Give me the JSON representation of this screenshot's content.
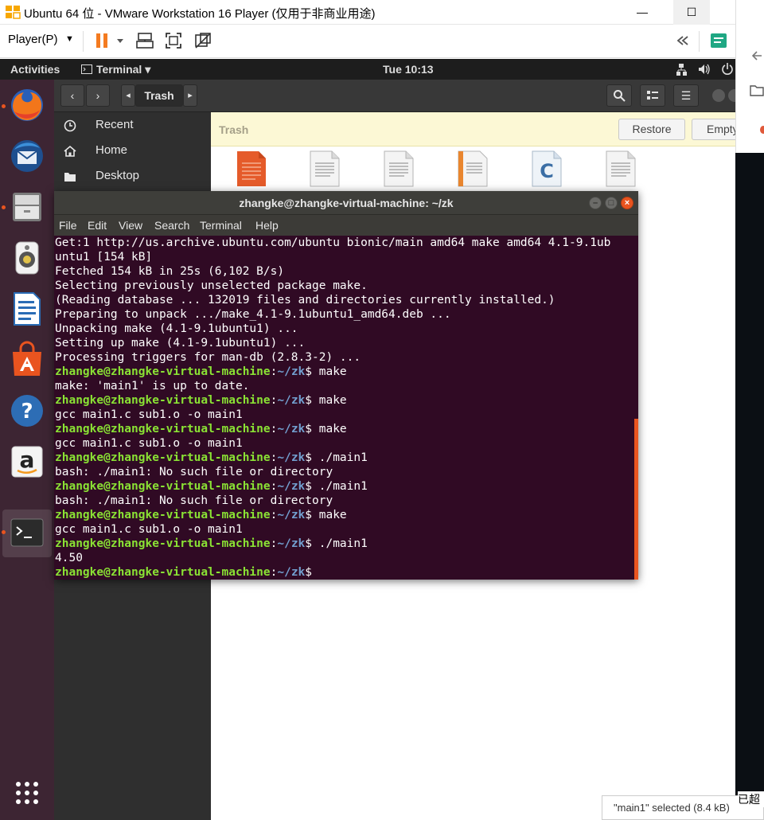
{
  "vmware": {
    "title": "Ubuntu 64 位 - VMware Workstation 16 Player (仅用于非商业用途)",
    "min_glyph": "—",
    "max_glyph": "☐",
    "player_menu": "Player(P)",
    "caret": "▼",
    "icons": [
      "pause-icon",
      "send-ctrl-alt-del-icon",
      "fit-guest-icon",
      "unity-icon",
      "collapse-icon",
      "notes-icon"
    ],
    "accent": "#f47b20"
  },
  "ubuntu": {
    "activities": "Activities",
    "app_menu": "Terminal ▾",
    "clock": "Tue 10:13",
    "dock_icons": [
      "firefox-icon",
      "thunderbird-icon",
      "files-icon",
      "rhythmbox-icon",
      "writer-icon",
      "software-center-icon",
      "help-icon",
      "amazon-icon",
      "terminal-icon",
      "show-apps-icon"
    ]
  },
  "nautilus": {
    "breadcrumb": "Trash",
    "sidebar": [
      {
        "label": "Recent",
        "icon": "clock-icon"
      },
      {
        "label": "Home",
        "icon": "home-icon"
      },
      {
        "label": "Desktop",
        "icon": "folder-icon"
      }
    ],
    "trash_label": "Trash",
    "restore": "Restore",
    "empty": "Empty"
  },
  "terminal": {
    "title": "zhangke@zhangke-virtual-machine: ~/zk",
    "menu": [
      "File",
      "Edit",
      "View",
      "Search",
      "Terminal",
      "Help"
    ],
    "prompt_user": "zhangke@zhangke-virtual-machine",
    "prompt_path": "~/zk",
    "lines": [
      {
        "t": "out",
        "text": "Get:1 http://us.archive.ubuntu.com/ubuntu bionic/main amd64 make amd64 4.1-9.1ub"
      },
      {
        "t": "out",
        "text": "untu1 [154 kB]"
      },
      {
        "t": "out",
        "text": "Fetched 154 kB in 25s (6,102 B/s)"
      },
      {
        "t": "out",
        "text": "Selecting previously unselected package make."
      },
      {
        "t": "out",
        "text": "(Reading database ... 132019 files and directories currently installed.)"
      },
      {
        "t": "out",
        "text": "Preparing to unpack .../make_4.1-9.1ubuntu1_amd64.deb ..."
      },
      {
        "t": "out",
        "text": "Unpacking make (4.1-9.1ubuntu1) ..."
      },
      {
        "t": "out",
        "text": "Setting up make (4.1-9.1ubuntu1) ..."
      },
      {
        "t": "out",
        "text": "Processing triggers for man-db (2.8.3-2) ..."
      },
      {
        "t": "cmd",
        "text": " make"
      },
      {
        "t": "out",
        "text": "make: 'main1' is up to date."
      },
      {
        "t": "cmd",
        "text": " make"
      },
      {
        "t": "out",
        "text": "gcc main1.c sub1.o -o main1"
      },
      {
        "t": "cmd",
        "text": " make"
      },
      {
        "t": "out",
        "text": "gcc main1.c sub1.o -o main1"
      },
      {
        "t": "cmd",
        "text": " ./main1"
      },
      {
        "t": "out",
        "text": "bash: ./main1: No such file or directory"
      },
      {
        "t": "cmd",
        "text": " ./main1"
      },
      {
        "t": "out",
        "text": "bash: ./main1: No such file or directory"
      },
      {
        "t": "cmd",
        "text": " make"
      },
      {
        "t": "out",
        "text": "gcc main1.c sub1.o -o main1"
      },
      {
        "t": "cmd",
        "text": " ./main1"
      },
      {
        "t": "out",
        "text": "4.50"
      },
      {
        "t": "cmd",
        "text": ""
      }
    ]
  },
  "host": {
    "status_text": "\"main1\" selected (8.4 kB)",
    "side_text": "已超"
  }
}
